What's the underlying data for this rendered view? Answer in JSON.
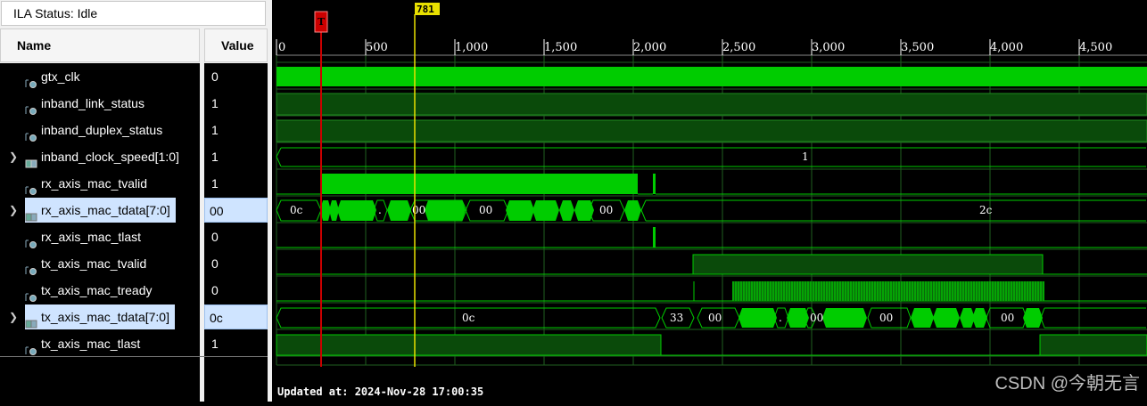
{
  "ila_status": "ILA Status: Idle",
  "columns": {
    "name": "Name",
    "value": "Value"
  },
  "signals": [
    {
      "name": "gtx_clk",
      "value": "0"
    },
    {
      "name": "inband_link_status",
      "value": "1"
    },
    {
      "name": "inband_duplex_status",
      "value": "1"
    },
    {
      "name": "inband_clock_speed[1:0]",
      "value": "1"
    },
    {
      "name": "rx_axis_mac_tvalid",
      "value": "1"
    },
    {
      "name": "rx_axis_mac_tdata[7:0]",
      "value": "00"
    },
    {
      "name": "rx_axis_mac_tlast",
      "value": "0"
    },
    {
      "name": "tx_axis_mac_tvalid",
      "value": "0"
    },
    {
      "name": "tx_axis_mac_tready",
      "value": "0"
    },
    {
      "name": "tx_axis_mac_tdata[7:0]",
      "value": "0c"
    },
    {
      "name": "tx_axis_mac_tlast",
      "value": "1"
    }
  ],
  "ruler": [
    "0",
    "500",
    "1,000",
    "1,500",
    "2,000",
    "2,500",
    "3,000",
    "3,500",
    "4,000",
    "4,500"
  ],
  "trigger_marker": "T",
  "cursor_marker": "781",
  "bus_labels": {
    "clock_speed": "1",
    "rx_first": "0c",
    "rx_dot": ".",
    "rx_a": "00",
    "rx_b": "00",
    "rx_c": "00",
    "rx_last": "2c",
    "tx_first": "0c",
    "tx_33": "33",
    "tx_a": "00",
    "tx_dot": ".",
    "tx_b": "00",
    "tx_c": "00",
    "tx_d": "00"
  },
  "updated_at": "Updated at: 2024-Nov-28 17:00:35",
  "watermark": "CSDN @今朝无言",
  "colors": {
    "waveform": "#00cc00",
    "waveform_dim": "#0a4a0a",
    "trigger": "#cc0000",
    "cursor": "#e8e000"
  }
}
